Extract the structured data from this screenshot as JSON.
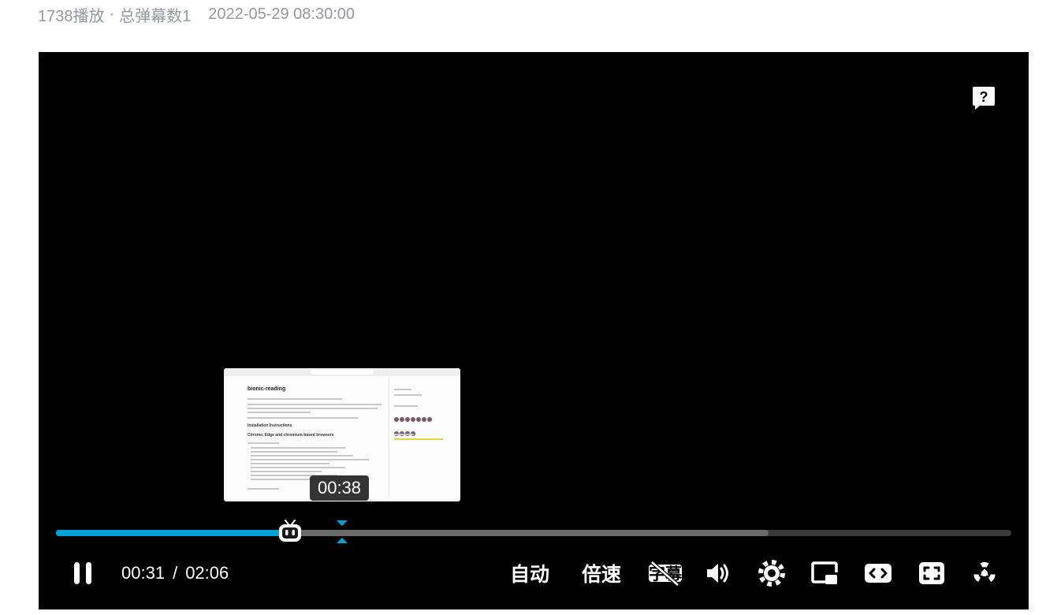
{
  "meta": {
    "plays": "1738播放",
    "separator": "·",
    "danmaku": "总弹幕数1",
    "date": "2022-05-29 08:30:00"
  },
  "player": {
    "help_icon": "question-bubble-icon",
    "preview": {
      "page_title": "bionic-reading",
      "heading_1": "Installation Instructions",
      "heading_2": "Chrome, Edge and chromium-based browsers"
    },
    "hover_time": "00:38",
    "progress": {
      "played": 0.245,
      "buffered": 0.746
    },
    "controls": {
      "current_time": "00:31",
      "time_separator": "/",
      "duration": "02:06",
      "quality_label": "自动",
      "speed_label": "倍速",
      "subtitle_label": "字幕"
    },
    "icons": {
      "pause": "pause-icon",
      "subtitle": "subtitle-off-icon",
      "volume": "volume-icon",
      "settings": "gear-icon",
      "pip": "picture-in-picture-icon",
      "widescreen": "widescreen-icon",
      "fullscreen": "fullscreen-icon",
      "radiation": "radiation-icon"
    },
    "colors": {
      "accent": "#00a1d6",
      "meta_text": "#9499a0"
    }
  }
}
